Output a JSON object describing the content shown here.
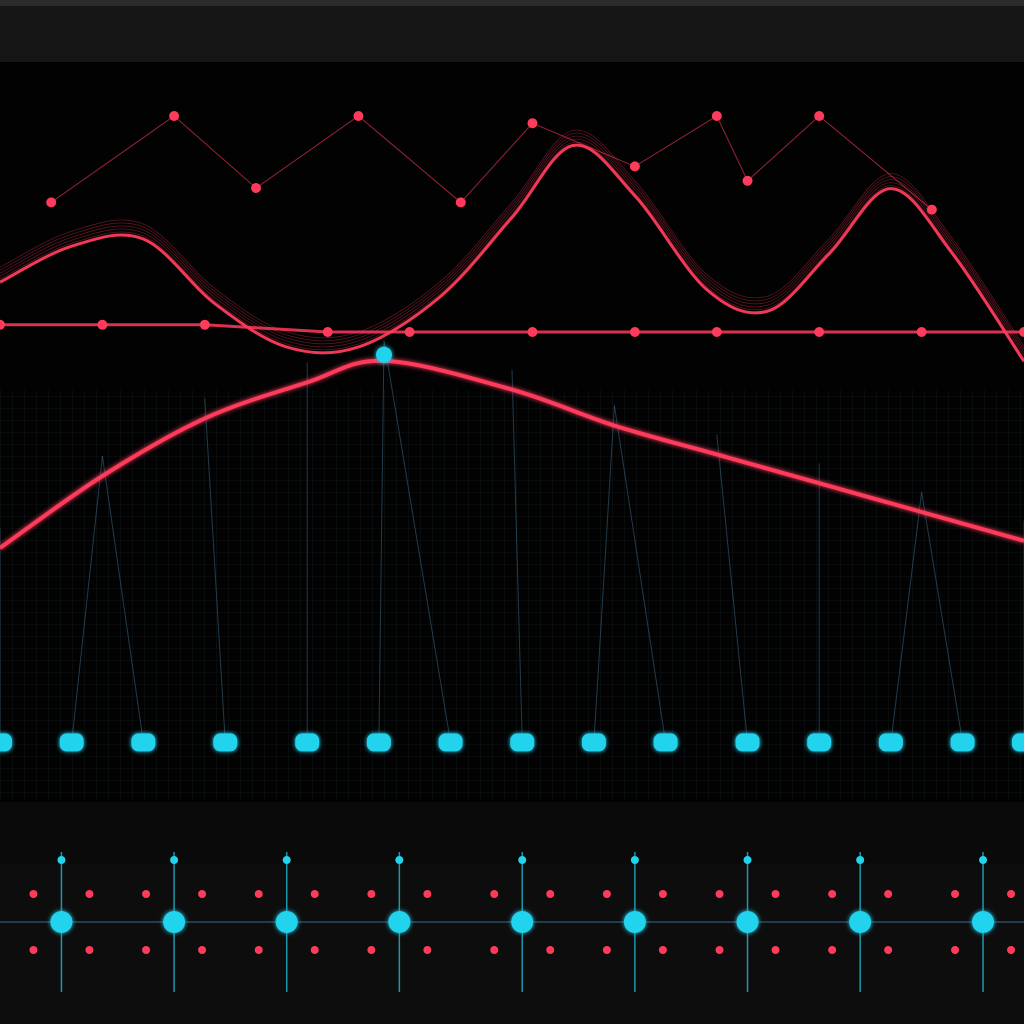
{
  "colors": {
    "background": "#000000",
    "panel": "#0d0d0d",
    "accent_red": "#ff3b5c",
    "accent_cyan": "#22d3ee",
    "line_blue": "#3a6a8a",
    "text_gray": "#9a9a9a"
  },
  "icons": [
    "node-icon",
    "signal-marker-icon"
  ],
  "chart_data": [
    {
      "type": "line",
      "title": "",
      "xlabel": "",
      "ylabel": "",
      "grid": true,
      "legend": "none",
      "xlim": [
        0,
        10
      ],
      "ylim": [
        0,
        10
      ],
      "series": [
        {
          "x": [
            0,
            0.7,
            1.4,
            2.1,
            2.8,
            3.5,
            4.3,
            5.0,
            5.6,
            6.2,
            6.9,
            7.5,
            8.1,
            8.7,
            9.3,
            10.0
          ],
          "y": [
            7.4,
            7.9,
            8.0,
            7.1,
            6.5,
            6.5,
            7.2,
            8.3,
            9.3,
            8.6,
            7.3,
            7.0,
            7.8,
            8.7,
            7.8,
            6.3
          ]
        },
        {
          "x": [
            0,
            1.0,
            2.0,
            3.0,
            3.75,
            5.0,
            6.0,
            7.0,
            8.0,
            9.0,
            10.0
          ],
          "y": [
            3.5,
            4.5,
            5.3,
            5.8,
            6.1,
            5.7,
            5.2,
            4.8,
            4.4,
            4.0,
            3.6
          ]
        },
        {
          "x": [
            0.5,
            1.7,
            2.5,
            3.5,
            4.5,
            5.2,
            6.2,
            7.0,
            7.3,
            8.0,
            9.1
          ],
          "y": [
            8.3,
            9.5,
            8.5,
            9.5,
            8.3,
            9.4,
            8.8,
            9.5,
            8.6,
            9.5,
            8.2
          ]
        },
        {
          "x": [
            0,
            1.0,
            2.0,
            3.2,
            4.0,
            5.2,
            6.2,
            7.0,
            8.0,
            9.0,
            10.0
          ],
          "y": [
            6.6,
            6.6,
            6.6,
            6.5,
            6.5,
            6.5,
            6.5,
            6.5,
            6.5,
            6.5,
            6.5
          ]
        },
        {
          "x": [
            0,
            0.7,
            1.4,
            2.2,
            3.0,
            3.7,
            4.4,
            5.1,
            5.8,
            6.5,
            7.3,
            8.0,
            8.7,
            9.4,
            10.0
          ],
          "y": [
            0.8,
            0.8,
            0.8,
            0.8,
            0.8,
            0.8,
            0.8,
            0.8,
            0.8,
            0.8,
            0.8,
            0.8,
            0.8,
            0.8,
            0.8
          ]
        }
      ]
    },
    {
      "type": "scatter",
      "title": "",
      "xlabel": "",
      "ylabel": "",
      "legend": "none",
      "xlim": [
        0,
        10
      ],
      "ylim": [
        0,
        10
      ],
      "series": [
        {
          "x": [
            0.6,
            1.7,
            2.8,
            3.9,
            5.1,
            6.2,
            7.3,
            8.4,
            9.6
          ],
          "y": [
            5,
            5,
            5,
            5,
            5,
            5,
            5,
            5,
            5
          ]
        }
      ]
    }
  ]
}
